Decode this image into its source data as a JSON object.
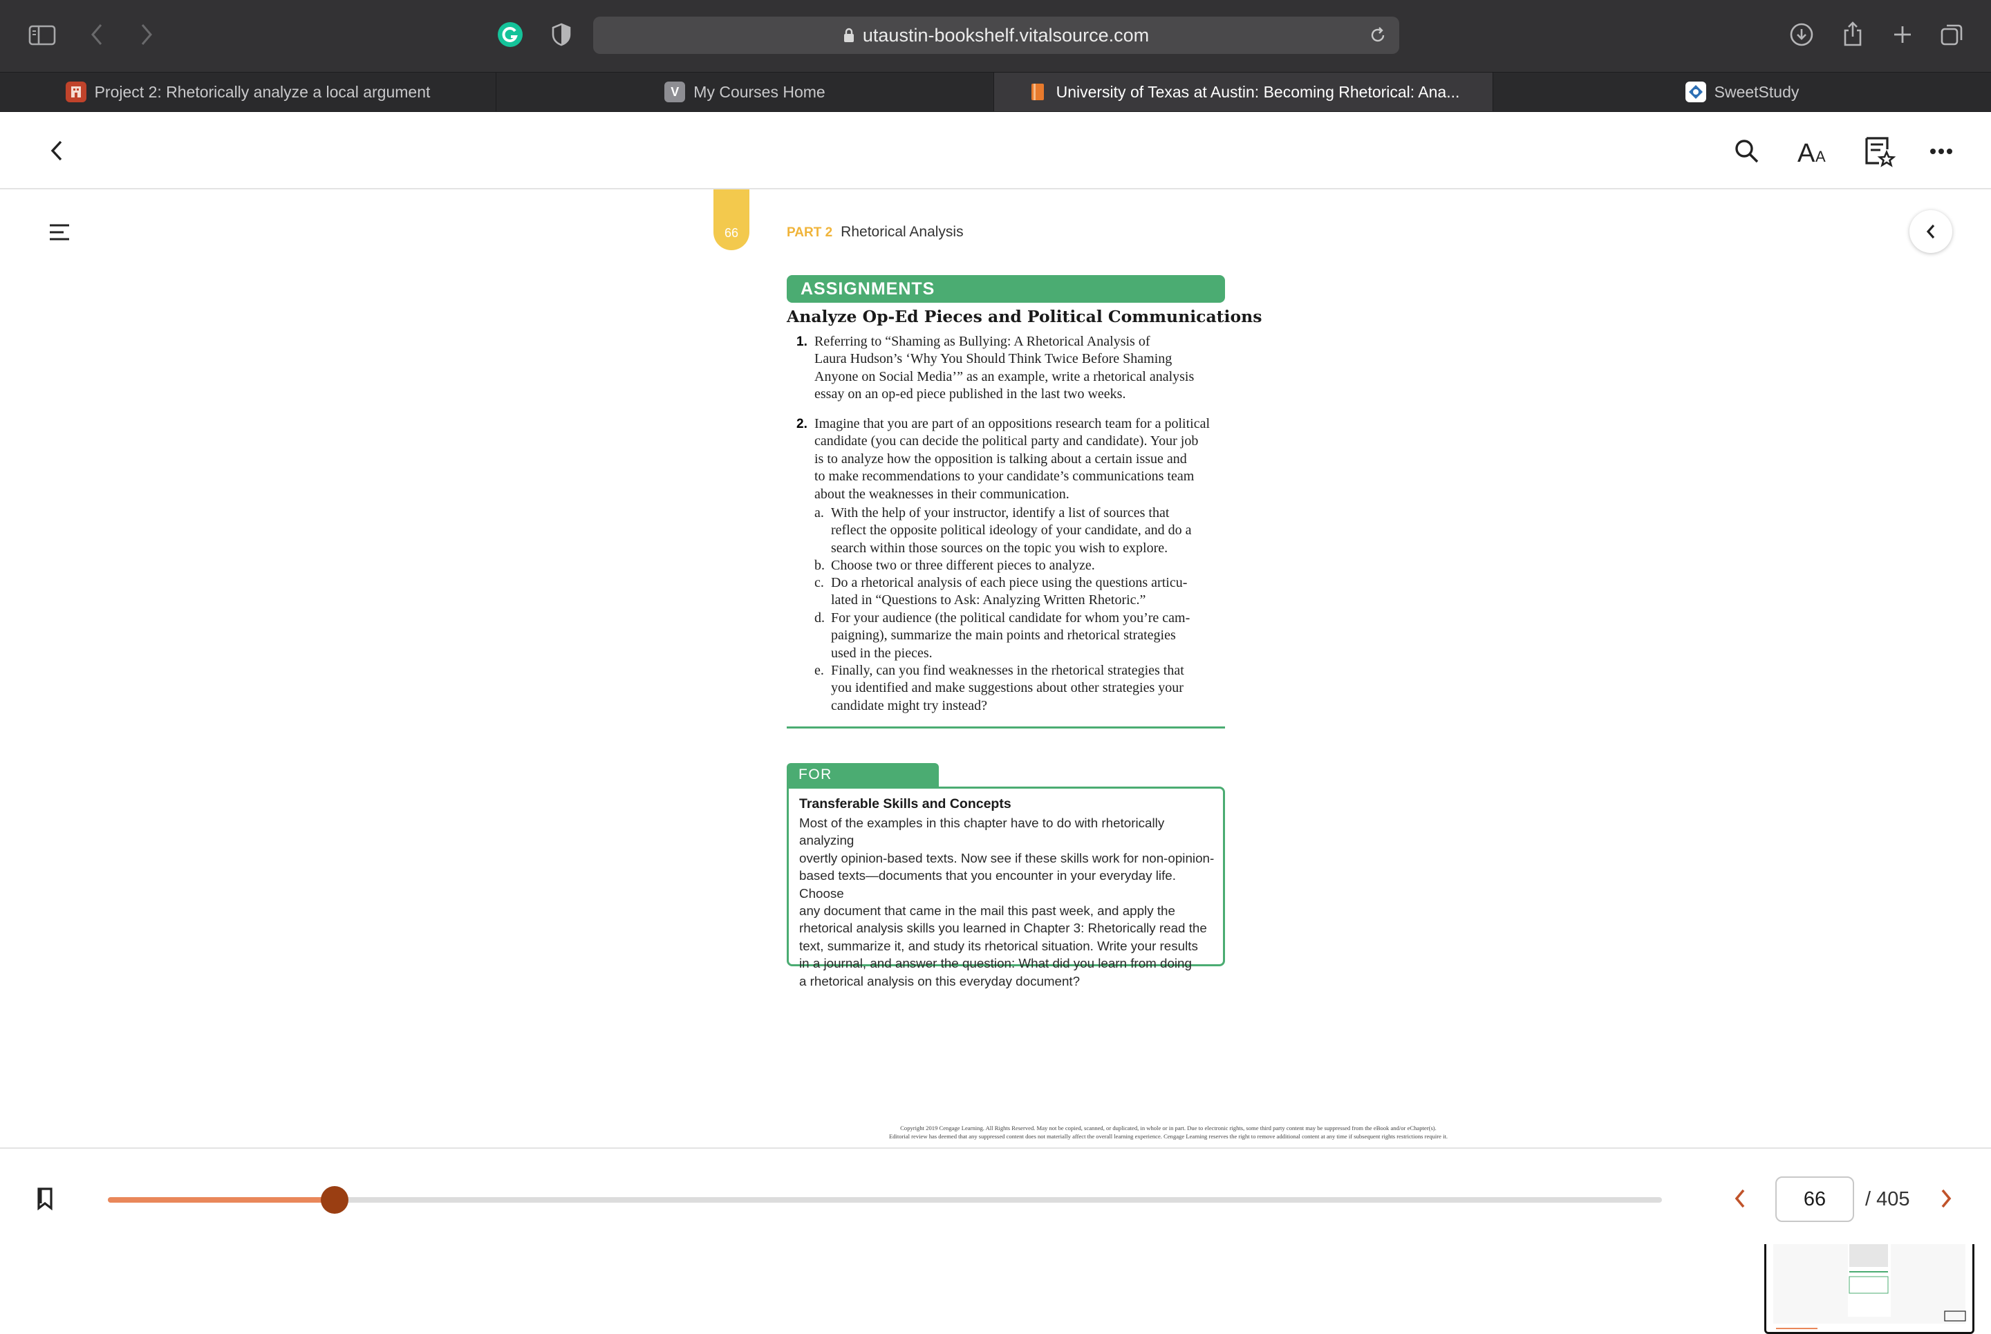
{
  "browser": {
    "url": "utaustin-bookshelf.vitalsource.com"
  },
  "tabs": [
    {
      "label": "Project 2: Rhetorically analyze a local argument",
      "active": false,
      "favicon_color": "#c0432b"
    },
    {
      "label": "My Courses Home",
      "active": false,
      "favicon_letter": "V",
      "favicon_color": "#8e8e93"
    },
    {
      "label": "University of Texas at Austin: Becoming Rhetorical: Ana...",
      "active": true,
      "favicon_color": "#e87a2c"
    },
    {
      "label": "SweetStudy",
      "active": false,
      "favicon_color": "#2d6fb4"
    }
  ],
  "page": {
    "page_tab_number": "66",
    "running_head_part": "PART 2",
    "running_head_title": "Rhetorical Analysis",
    "assignments_heading": "ASSIGNMENTS",
    "assignments_title": "Analyze Op-Ed Pieces and Political Communications",
    "item1_number": "1.",
    "item1_lines": [
      "Referring to “Shaming as Bullying: A Rhetorical Analysis of",
      "Laura Hudson’s ‘Why You Should Think Twice Before Shaming",
      "Anyone on Social Media’” as an example, write a rhetorical analysis",
      "essay on an op-ed piece published in the last two weeks."
    ],
    "item2_number": "2.",
    "item2_lines": [
      "Imagine that you are part of an oppositions research team for a political",
      "candidate (you can decide the political party and candidate). Your job",
      "is to analyze how the opposition is talking about a certain issue and",
      "to make recommendations to your candidate’s communications team",
      "about the weaknesses in their communication."
    ],
    "subitems": [
      {
        "letter": "a.",
        "lines": [
          "With the help of your instructor, identify a list of sources that",
          "reflect the opposite political ideology of your candidate, and do a",
          "search within those sources on the topic you wish to explore."
        ]
      },
      {
        "letter": "b.",
        "lines": [
          "Choose two or three different pieces to analyze."
        ]
      },
      {
        "letter": "c.",
        "lines": [
          "Do a rhetorical analysis of each piece using the questions articu-",
          "lated in “Questions to Ask: Analyzing Written Rhetoric.”"
        ]
      },
      {
        "letter": "d.",
        "lines": [
          "For your audience (the political candidate for whom you’re cam-",
          "paigning), summarize the main points and rhetorical strategies",
          "used in the pieces."
        ]
      },
      {
        "letter": "e.",
        "lines": [
          "Finally, can you find weaknesses in the rhetorical strategies that",
          "you identified and make suggestions about other strategies your",
          "candidate might try instead?"
        ]
      }
    ],
    "reflection_label": "FOR REFLECTION",
    "reflection_heading": "Transferable Skills and Concepts",
    "reflection_lines": [
      "Most of the examples in this chapter have to do with rhetorically analyzing",
      "overtly opinion-based texts. Now see if these skills work for non-opinion-",
      "based texts—documents that you encounter in your everyday life. Choose",
      "any document that came in the mail this past week, and apply the",
      "rhetorical analysis skills you learned in Chapter 3: Rhetorically read the",
      "text, summarize it, and study its rhetorical situation. Write your results",
      "in a journal, and answer the question: What did you learn from doing",
      "a rhetorical analysis on this everyday document?"
    ],
    "copyright_lines": [
      "Copyright 2019 Cengage Learning. All Rights Reserved. May not be copied, scanned, or duplicated, in whole or in part. Due to electronic rights, some third party content may be suppressed from the eBook and/or eChapter(s).",
      "Editorial review has deemed that any suppressed content does not materially affect the overall learning experience. Cengage Learning reserves the right to remove additional content at any time if subsequent rights restrictions require it."
    ]
  },
  "navigation": {
    "current_page": "66",
    "total_pages": "/ 405",
    "progress_fraction": 0.146
  },
  "colors": {
    "accent_green": "#4bac72",
    "accent_orange": "#e9875a",
    "slider_thumb": "#9a3e12",
    "nav_arrow": "#c0532a"
  }
}
